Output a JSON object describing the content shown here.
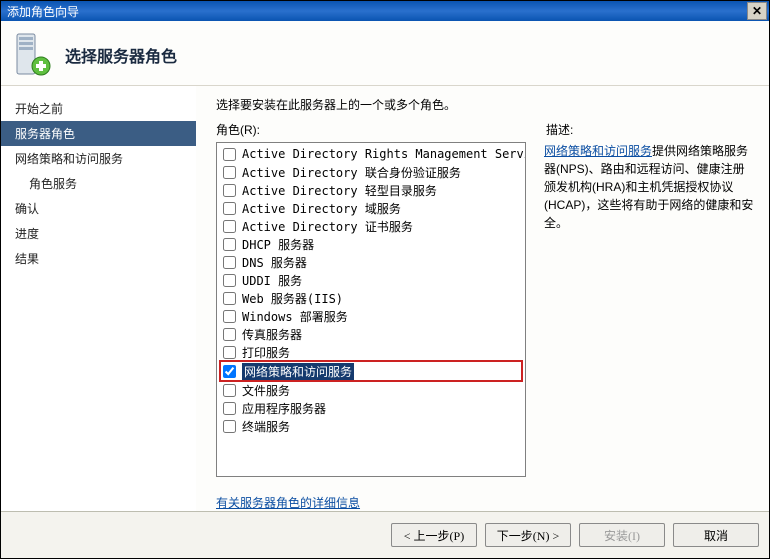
{
  "window": {
    "title": "添加角色向导"
  },
  "header": {
    "title": "选择服务器角色"
  },
  "sidebar": {
    "items": [
      {
        "label": "开始之前"
      },
      {
        "label": "服务器角色"
      },
      {
        "label": "网络策略和访问服务"
      },
      {
        "label": "角色服务"
      },
      {
        "label": "确认"
      },
      {
        "label": "进度"
      },
      {
        "label": "结果"
      }
    ]
  },
  "main": {
    "instruction": "选择要安装在此服务器上的一个或多个角色。",
    "roles_label": "角色(R):",
    "desc_label": "描述:",
    "roles": [
      {
        "label": "Active Directory Rights Management Services",
        "checked": false
      },
      {
        "label": "Active Directory 联合身份验证服务",
        "checked": false
      },
      {
        "label": "Active Directory 轻型目录服务",
        "checked": false
      },
      {
        "label": "Active Directory 域服务",
        "checked": false
      },
      {
        "label": "Active Directory 证书服务",
        "checked": false
      },
      {
        "label": "DHCP 服务器",
        "checked": false
      },
      {
        "label": "DNS 服务器",
        "checked": false
      },
      {
        "label": "UDDI 服务",
        "checked": false
      },
      {
        "label": "Web 服务器(IIS)",
        "checked": false
      },
      {
        "label": "Windows 部署服务",
        "checked": false
      },
      {
        "label": "传真服务器",
        "checked": false
      },
      {
        "label": "打印服务",
        "checked": false
      },
      {
        "label": "网络策略和访问服务",
        "checked": true,
        "highlight": true
      },
      {
        "label": "文件服务",
        "checked": false
      },
      {
        "label": "应用程序服务器",
        "checked": false
      },
      {
        "label": "终端服务",
        "checked": false
      }
    ],
    "description": {
      "link_text": "网络策略和访问服务",
      "body": "提供网络策略服务器(NPS)、路由和远程访问、健康注册颁发机构(HRA)和主机凭据授权协议(HCAP)，这些将有助于网络的健康和安全。"
    },
    "more_info": "有关服务器角色的详细信息"
  },
  "footer": {
    "prev": "< 上一步(P)",
    "next": "下一步(N) >",
    "install": "安装(I)",
    "cancel": "取消"
  }
}
